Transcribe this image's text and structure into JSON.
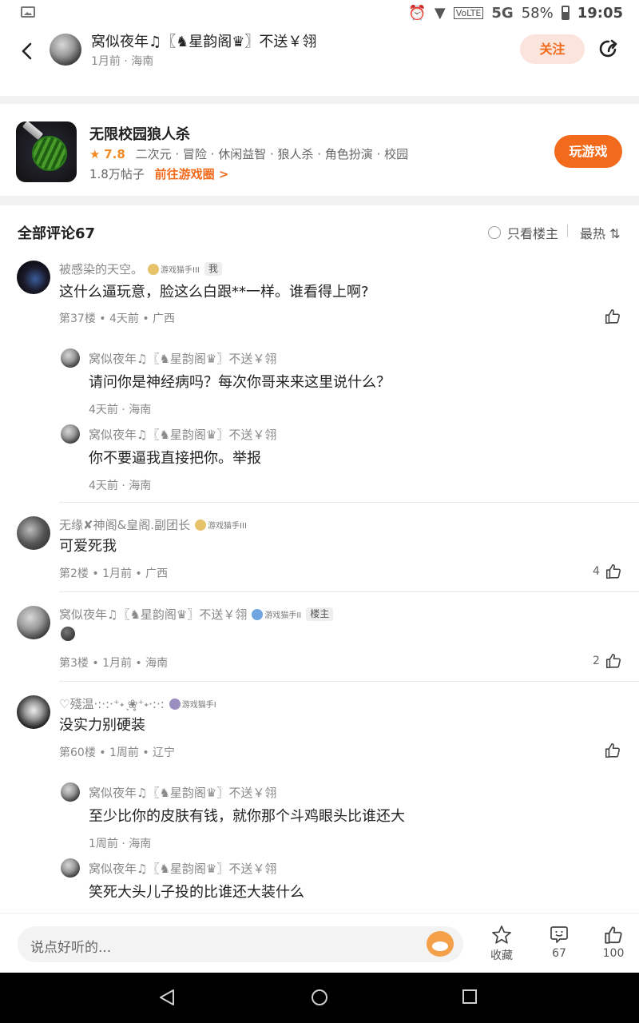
{
  "status_bar": {
    "battery": "58%",
    "time": "19:05",
    "network": "5G",
    "volte": "VoLTE"
  },
  "header": {
    "title": "窝似夜年♫〖♞星韵阁♛〗不送￥翎",
    "meta": "1月前 · 海南",
    "follow_label": "关注"
  },
  "game": {
    "name": "无限校园狼人杀",
    "star": "★",
    "rating": "7.8",
    "tags": "二次元 · 冒险 · 休闲益智 · 狼人杀 · 角色扮演 · 校园",
    "posts": "1.8万帖子",
    "link": "前往游戏圈 >",
    "play_label": "玩游戏"
  },
  "comments_header": {
    "title": "全部评论67",
    "owner_only": "只看楼主",
    "sort": "最热 ⇅"
  },
  "comments": [
    {
      "user": "被感染的天空。",
      "badge": "游戏猫手III",
      "tag": "我",
      "text": "这什么逼玩意，脸这么白跟**一样。谁看得上啊?",
      "meta": "第37楼 • 4天前 • 广西",
      "likes": "",
      "replies": [
        {
          "user": "窝似夜年♫〖♞星韵阁♛〗不送￥翎",
          "text": "请问你是神经病吗？每次你哥来来这里说什么？",
          "meta": "4天前 · 海南"
        },
        {
          "user": "窝似夜年♫〖♞星韵阁♛〗不送￥翎",
          "text": "你不要逼我直接把你。举报",
          "meta": "4天前 · 海南"
        }
      ]
    },
    {
      "user": "无缘✘神阁&皇阁.副团长",
      "badge": "游戏猫手III",
      "text": "可爱死我",
      "meta": "第2楼 • 1月前 • 广西",
      "likes": "4"
    },
    {
      "user": "窝似夜年♫〖♞星韵阁♛〗不送￥翎",
      "badge": "游戏猫手II",
      "tag": "楼主",
      "text": "",
      "meta": "第3楼 • 1月前 • 海南",
      "likes": "2"
    },
    {
      "user": "♡殘温·:·:·⁺˖ ͙❀̥⁺˖·:·:",
      "badge": "游戏猫手I",
      "text": "没实力别硬装",
      "meta": "第60楼 • 1周前 • 辽宁",
      "likes": "",
      "replies": [
        {
          "user": "窝似夜年♫〖♞星韵阁♛〗不送￥翎",
          "text": "至少比你的皮肤有钱，就你那个斗鸡眼头比谁还大",
          "meta": "1周前 · 海南"
        },
        {
          "user": "窝似夜年♫〖♞星韵阁♛〗不送￥翎",
          "text": "笑死大头儿子投的比谁还大装什么"
        }
      ]
    }
  ],
  "bottom_bar": {
    "input_placeholder": "说点好听的...",
    "favorite_label": "收藏",
    "comment_count": "67",
    "like_count": "100"
  },
  "colors": {
    "accent": "#f26a1b",
    "follow_bg": "#fbe4dc",
    "text_gray": "#888888"
  }
}
